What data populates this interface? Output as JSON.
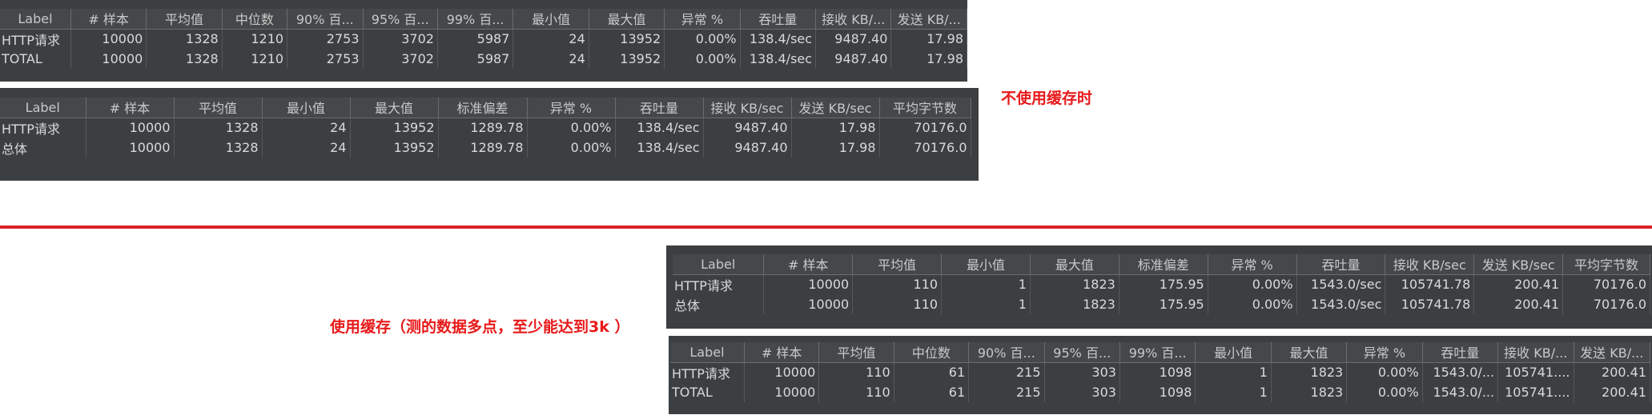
{
  "panel1": {
    "headers": [
      "Label",
      "# 样本",
      "平均值",
      "中位数",
      "90% 百...",
      "95% 百...",
      "99% 百...",
      "最小值",
      "最大值",
      "异常 %",
      "吞吐量",
      "接收 KB/...",
      "发送 KB/..."
    ],
    "rows": [
      [
        "HTTP请求",
        "10000",
        "1328",
        "1210",
        "2753",
        "3702",
        "5987",
        "24",
        "13952",
        "0.00%",
        "138.4/sec",
        "9487.40",
        "17.98"
      ],
      [
        "TOTAL",
        "10000",
        "1328",
        "1210",
        "2753",
        "3702",
        "5987",
        "24",
        "13952",
        "0.00%",
        "138.4/sec",
        "9487.40",
        "17.98"
      ]
    ]
  },
  "panel2": {
    "headers": [
      "Label",
      "# 样本",
      "平均值",
      "最小值",
      "最大值",
      "标准偏差",
      "异常 %",
      "吞吐量",
      "接收 KB/sec",
      "发送 KB/sec",
      "平均字节数"
    ],
    "rows": [
      [
        "HTTP请求",
        "10000",
        "1328",
        "24",
        "13952",
        "1289.78",
        "0.00%",
        "138.4/sec",
        "9487.40",
        "17.98",
        "70176.0"
      ],
      [
        "总体",
        "10000",
        "1328",
        "24",
        "13952",
        "1289.78",
        "0.00%",
        "138.4/sec",
        "9487.40",
        "17.98",
        "70176.0"
      ]
    ]
  },
  "panel3": {
    "headers": [
      "Label",
      "# 样本",
      "平均值",
      "最小值",
      "最大值",
      "标准偏差",
      "异常 %",
      "吞吐量",
      "接收 KB/sec",
      "发送 KB/sec",
      "平均字节数"
    ],
    "rows": [
      [
        "HTTP请求",
        "10000",
        "110",
        "1",
        "1823",
        "175.95",
        "0.00%",
        "1543.0/sec",
        "105741.78",
        "200.41",
        "70176.0"
      ],
      [
        "总体",
        "10000",
        "110",
        "1",
        "1823",
        "175.95",
        "0.00%",
        "1543.0/sec",
        "105741.78",
        "200.41",
        "70176.0"
      ]
    ]
  },
  "panel4": {
    "headers": [
      "Label",
      "# 样本",
      "平均值",
      "中位数",
      "90% 百...",
      "95% 百...",
      "99% 百...",
      "最小值",
      "最大值",
      "异常 %",
      "吞吐量",
      "接收 KB/...",
      "发送 KB/..."
    ],
    "rows": [
      [
        "HTTP请求",
        "10000",
        "110",
        "61",
        "215",
        "303",
        "1098",
        "1",
        "1823",
        "0.00%",
        "1543.0/...",
        "105741....",
        "200.41"
      ],
      [
        "TOTAL",
        "10000",
        "110",
        "61",
        "215",
        "303",
        "1098",
        "1",
        "1823",
        "0.00%",
        "1543.0/...",
        "105741....",
        "200.41"
      ]
    ]
  },
  "annotations": {
    "no_cache": "不使用缓存时",
    "with_cache": "使用缓存（测的数据多点，至少能达到3k ）"
  },
  "colors": {
    "panel_bg": "#3c3f41",
    "header_bg": "#45484a",
    "text": "#d9d9d9",
    "annotation_red": "#e8191a",
    "divider_red": "#d9232a"
  }
}
